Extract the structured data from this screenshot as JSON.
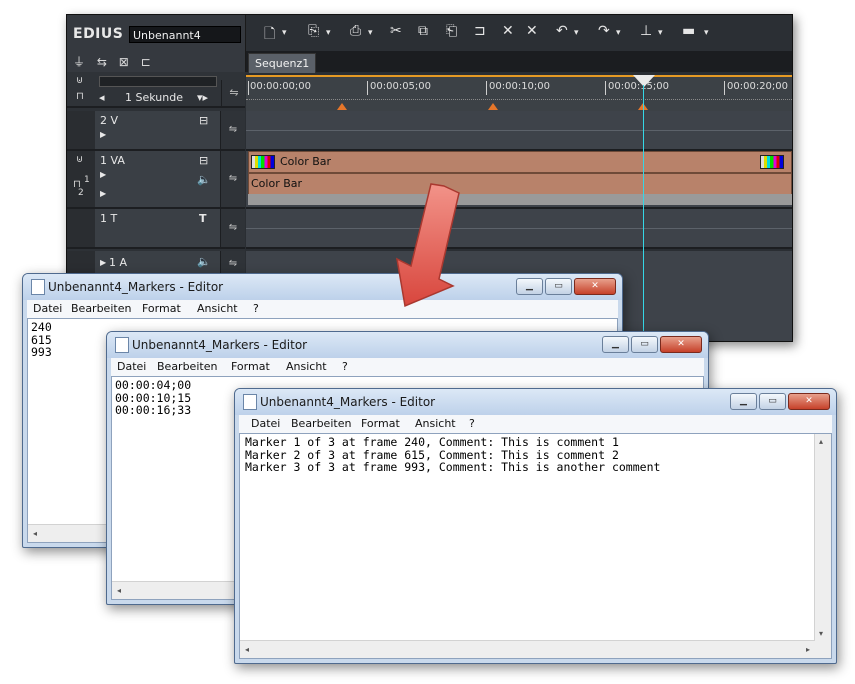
{
  "edius": {
    "logo": "EDIUS",
    "project_name": "Unbenannt4",
    "sequence_tab": "Sequenz1",
    "zoom_label": "1 Sekunde",
    "timecodes": [
      "00:00:00;00",
      "00:00:05;00",
      "00:00:10;00",
      "00:00:15;00",
      "00:00:20;00"
    ],
    "tracks": [
      {
        "name": "2 V"
      },
      {
        "name": "1 VA"
      },
      {
        "name": "1 T"
      },
      {
        "name": "1 A"
      }
    ],
    "clips": {
      "video": "Color Bar",
      "audio": "Color Bar"
    },
    "track_labels": {
      "sub_a": "1",
      "sub_b": "2"
    }
  },
  "notepad": {
    "title": "Unbenannt4_Markers - Editor",
    "menu": [
      "Datei",
      "Bearbeiten",
      "Format",
      "Ansicht",
      "?"
    ],
    "window1_text": "240\n615\n993",
    "window2_text": "00:00:04;00\n00:00:10;15\n00:00:16;33",
    "window3_text": "Marker 1 of 3 at frame 240, Comment: This is comment 1\nMarker 2 of 3 at frame 615, Comment: This is comment 2\nMarker 3 of 3 at frame 993, Comment: This is another comment"
  },
  "colors": {
    "arrow": "#e0524a",
    "playhead": "#35d7e6",
    "clip": "#b8826a"
  }
}
